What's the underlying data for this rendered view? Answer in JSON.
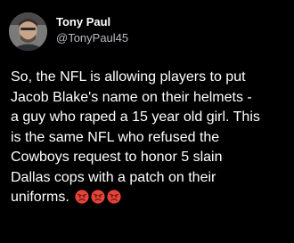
{
  "tweet": {
    "author": {
      "display_name": "Tony Paul",
      "handle": "@TonyPaul45"
    },
    "text_lines": [
      "So, the NFL is allowing players to put",
      "Jacob Blake's name on their helmets -",
      "a guy who raped a 15 year old girl. This",
      "is the same NFL who refused the",
      "Cowboys request to honor 5 slain",
      "Dallas cops with a patch on their",
      "uniforms."
    ],
    "emojis": [
      "angry-face-emoji",
      "angry-face-emoji",
      "angry-face-emoji"
    ]
  },
  "colors": {
    "background": "#000000",
    "text": "#ffffff",
    "handle": "#b8bcc0",
    "emoji": "#e8433a"
  }
}
